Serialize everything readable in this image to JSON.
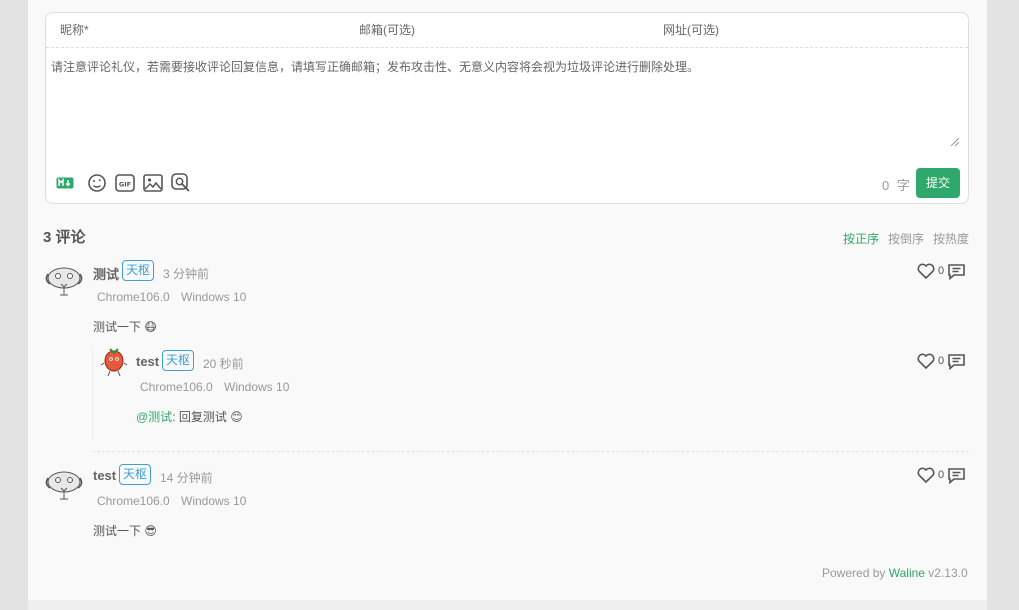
{
  "editor": {
    "nick_label": "昵称*",
    "mail_label": "邮箱(可选)",
    "link_label": "网址(可选)",
    "placeholder": "请注意评论礼仪，若需要接收评论回复信息，请填写正确邮箱；发布攻击性、无意义内容将会视为垃圾评论进行删除处理。",
    "word_count": "0",
    "word_unit": "字",
    "submit_label": "提交",
    "tools": [
      "markdown-icon",
      "emoji-icon",
      "gif-icon",
      "image-icon",
      "preview-icon"
    ]
  },
  "comments_header": {
    "count": "3",
    "label": "评论",
    "sort": [
      "按正序",
      "按倒序",
      "按热度"
    ]
  },
  "comments": [
    {
      "nick": "测试",
      "badge": "天枢",
      "time": "3 分钟前",
      "browser": "Chrome106.0",
      "os": "Windows 10",
      "content": "测试一下",
      "emoji": "😷",
      "likes": "0"
    },
    {
      "nick": "test",
      "badge": "天枢",
      "time": "20 秒前",
      "browser": "Chrome106.0",
      "os": "Windows 10",
      "mention": "@测试",
      "content": ": 回复测试",
      "emoji": "😊",
      "likes": "0"
    },
    {
      "nick": "test",
      "badge": "天枢",
      "time": "14 分钟前",
      "browser": "Chrome106.0",
      "os": "Windows 10",
      "content": "测试一下",
      "emoji": "😎",
      "likes": "0"
    }
  ],
  "footer": {
    "prefix": "Powered by",
    "link": "Waline",
    "version": "v2.13.0"
  },
  "colors": {
    "accent": "#2fa86b",
    "badge": "#3fa0d8"
  }
}
